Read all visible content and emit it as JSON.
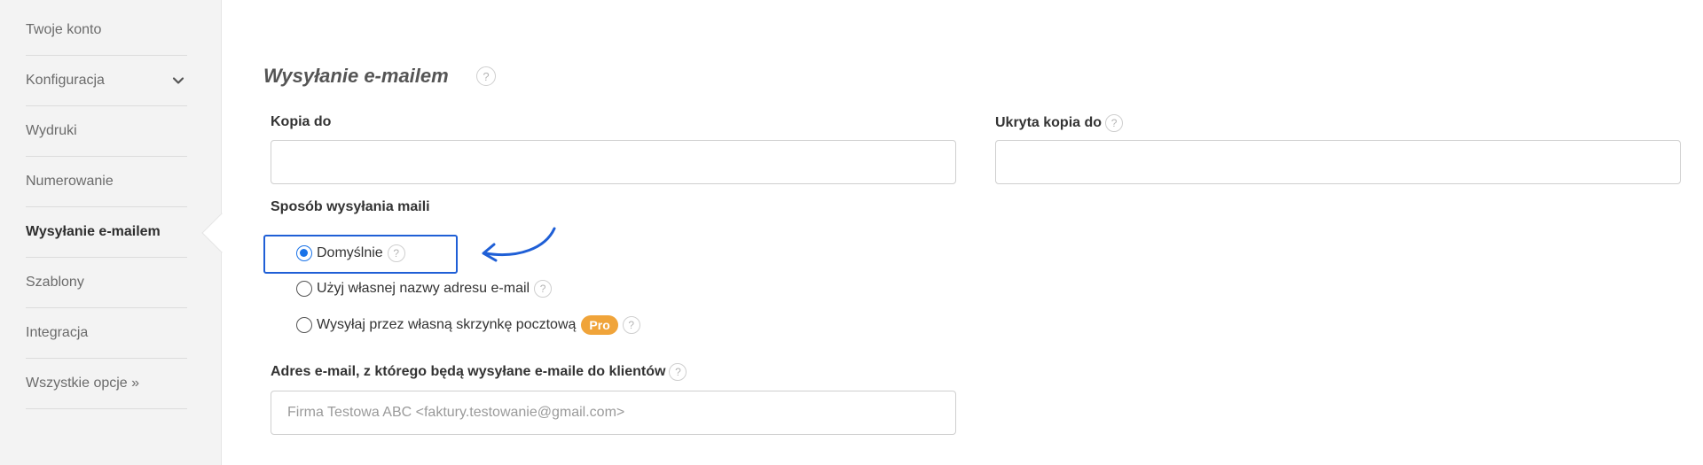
{
  "sidebar": {
    "items": [
      {
        "label": "Twoje konto"
      },
      {
        "label": "Konfiguracja",
        "icon": "chevron-down-icon"
      },
      {
        "label": "Wydruki"
      },
      {
        "label": "Numerowanie"
      },
      {
        "label": "Wysyłanie e-mailem",
        "active": true
      },
      {
        "label": "Szablony"
      },
      {
        "label": "Integracja"
      },
      {
        "label": "Wszystkie opcje",
        "suffix": "»"
      }
    ]
  },
  "main": {
    "title": "Wysyłanie e-mailem",
    "help_glyph": "?",
    "cc_label": "Kopia do",
    "cc_value": "",
    "bcc_label": "Ukryta kopia do",
    "bcc_value": "",
    "method_label": "Sposób wysyłania maili",
    "options": [
      {
        "label": "Domyślnie",
        "checked": true
      },
      {
        "label": "Użyj własnej nazwy adresu e-mail",
        "checked": false
      },
      {
        "label": "Wysyłaj przez własną skrzynkę pocztową",
        "checked": false,
        "badge": "Pro"
      }
    ],
    "from_label": "Adres e-mail, z którego będą wysyłane e-maile do klientów",
    "from_value": "Firma Testowa ABC <faktury.testowanie@gmail.com>"
  },
  "colors": {
    "accent": "#1a73e8",
    "highlight": "#1f5fd6",
    "pro_badge": "#f0a43a",
    "sidebar_bg": "#f3f3f3"
  }
}
